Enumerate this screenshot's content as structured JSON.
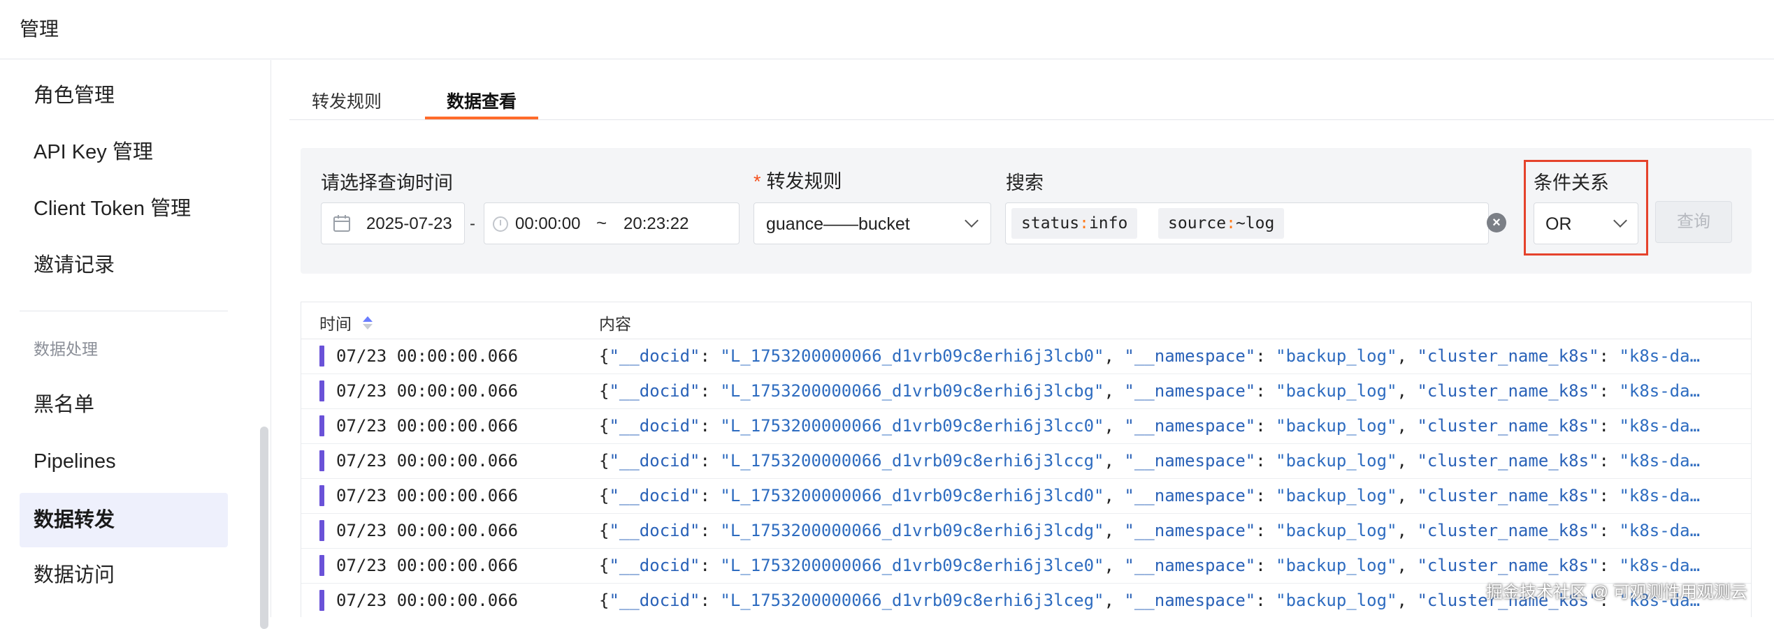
{
  "header": {
    "title": "管理"
  },
  "sidebar": {
    "items": [
      {
        "label": "角色管理"
      },
      {
        "label": "API Key 管理"
      },
      {
        "label": "Client Token 管理"
      },
      {
        "label": "邀请记录"
      }
    ],
    "section_title": "数据处理",
    "section_items": [
      {
        "label": "黑名单"
      },
      {
        "label": "Pipelines"
      },
      {
        "label": "数据转发",
        "active": true
      },
      {
        "label": "数据访问"
      }
    ]
  },
  "tabs": [
    {
      "label": "转发规则"
    },
    {
      "label": "数据查看",
      "active": true
    }
  ],
  "filters": {
    "time_label": "请选择查询时间",
    "date": "2025-07-23",
    "dash": "-",
    "start_time": "00:00:00",
    "tilde": "~",
    "end_time": "20:23:22",
    "rule_label": "转发规则",
    "rule_required": "*",
    "rule_value": "guance——bucket",
    "search_label": "搜索",
    "search_chips": [
      {
        "key": "status",
        "op": ":",
        "value": "info"
      },
      {
        "key": "source",
        "op": ":",
        "value": "~log"
      }
    ],
    "condition_label": "条件关系",
    "condition_value": "OR",
    "query_button": "查询"
  },
  "table": {
    "columns": [
      "时间",
      "内容"
    ],
    "rows": [
      {
        "time": "07/23 00:00:00.066",
        "docid": "L_1753200000066_d1vrb09c8erhi6j3lcb0"
      },
      {
        "time": "07/23 00:00:00.066",
        "docid": "L_1753200000066_d1vrb09c8erhi6j3lcbg"
      },
      {
        "time": "07/23 00:00:00.066",
        "docid": "L_1753200000066_d1vrb09c8erhi6j3lcc0"
      },
      {
        "time": "07/23 00:00:00.066",
        "docid": "L_1753200000066_d1vrb09c8erhi6j3lccg"
      },
      {
        "time": "07/23 00:00:00.066",
        "docid": "L_1753200000066_d1vrb09c8erhi6j3lcd0"
      },
      {
        "time": "07/23 00:00:00.066",
        "docid": "L_1753200000066_d1vrb09c8erhi6j3lcdg"
      },
      {
        "time": "07/23 00:00:00.066",
        "docid": "L_1753200000066_d1vrb09c8erhi6j3lce0"
      },
      {
        "time": "07/23 00:00:00.066",
        "docid": "L_1753200000066_d1vrb09c8erhi6j3lceg"
      }
    ],
    "content_tokens": {
      "open": "{",
      "docid_key": "\"__docid\"",
      "namespace_key": "\"__namespace\"",
      "namespace_value": "\"backup_log\"",
      "cluster_key": "\"cluster_name_k8s\"",
      "cluster_value": "\"k8s-da…"
    }
  },
  "watermark": "掘金技术社区 @ 可观测性用观测云",
  "colors": {
    "accent_tab": "#ff6b2b",
    "highlight_border": "#e5432c",
    "row_bar": "#6a52d8",
    "json_value": "#2e6cc0"
  }
}
